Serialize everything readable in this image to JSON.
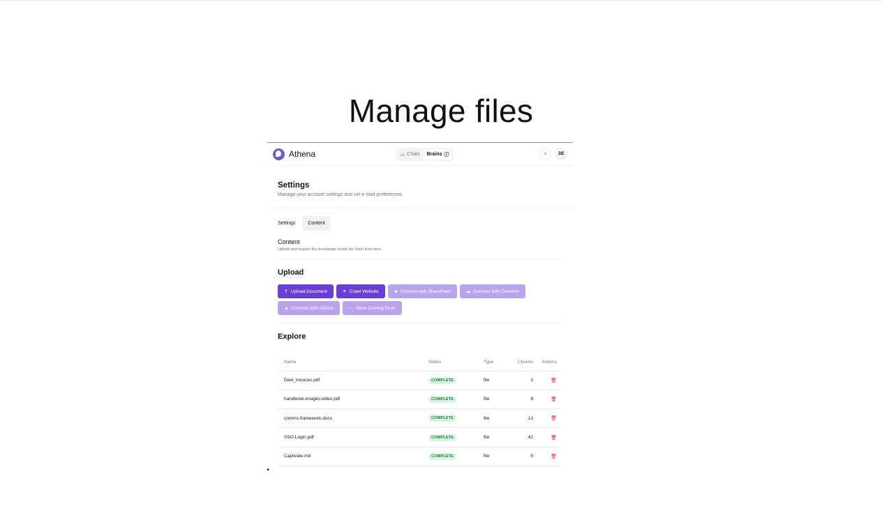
{
  "slide": {
    "title": "Manage files"
  },
  "app": {
    "logo_text": "Athena",
    "nav_tabs": [
      {
        "label": "Chats",
        "icon": "chat-icon"
      },
      {
        "label": "Brains",
        "icon": "info-icon"
      }
    ],
    "theme_icon": "sun-icon",
    "avatar": "DE"
  },
  "settings": {
    "title": "Settings",
    "subtitle": "Manage your account settings and set e-mail preferences.",
    "tabs": [
      "Settings",
      "Content"
    ]
  },
  "content_section": {
    "title": "Content",
    "subtitle": "Upload and inspect the knowledge inside the brain from here."
  },
  "upload": {
    "title": "Upload",
    "buttons": [
      {
        "label": "Upload Document",
        "icon": "cloud-upload-icon",
        "state": "enabled"
      },
      {
        "label": "Crawl Website",
        "icon": "link-icon",
        "state": "enabled"
      },
      {
        "label": "Connect with SharePoint",
        "icon": "sharepoint-icon",
        "state": "disabled"
      },
      {
        "label": "Connect with Onedrive",
        "icon": "cloud-icon",
        "state": "disabled"
      },
      {
        "label": "Connect with GDrive",
        "icon": "gdrive-icon",
        "state": "disabled"
      },
      {
        "label": "More Coming Soon",
        "icon": "more-icon",
        "state": "disabled"
      }
    ]
  },
  "explore": {
    "title": "Explore",
    "columns": [
      "Name",
      "Status",
      "Type",
      "Chunks",
      "Actions"
    ],
    "rows": [
      {
        "name": "Deel_invoices.pdf",
        "status": "COMPLETE",
        "type": "file",
        "chunks": "1"
      },
      {
        "name": "handbook-images-video.pdf",
        "status": "COMPLETE",
        "type": "file",
        "chunks": "8"
      },
      {
        "name": "comms-framework.docx",
        "status": "COMPLETE",
        "type": "file",
        "chunks": "13"
      },
      {
        "name": "SSO-Login.pdf",
        "status": "COMPLETE",
        "type": "file",
        "chunks": "42"
      },
      {
        "name": "Captivate.md",
        "status": "COMPLETE",
        "type": "file",
        "chunks": "5"
      }
    ]
  },
  "colors": {
    "primary": "#6a3fd6",
    "primary_disabled": "#b9a3ec",
    "badge_bg": "#d7f5df",
    "badge_text": "#15803d",
    "delete": "#e11d48"
  }
}
